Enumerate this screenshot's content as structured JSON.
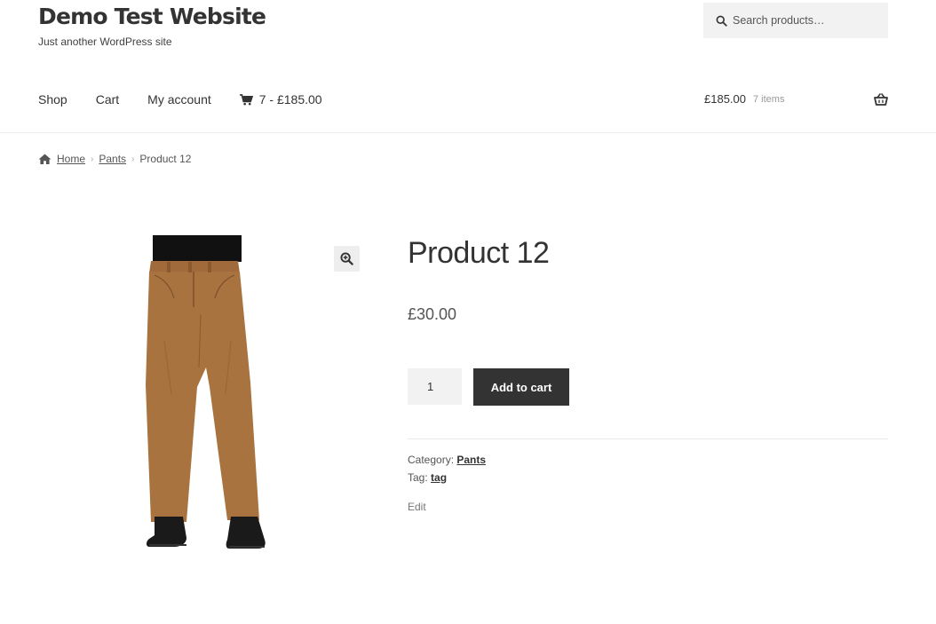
{
  "site": {
    "title": "Demo Test Website",
    "tagline": "Just another WordPress site"
  },
  "search": {
    "placeholder": "Search products…",
    "icon": "search-icon"
  },
  "nav": {
    "items": [
      {
        "label": "Shop"
      },
      {
        "label": "Cart"
      },
      {
        "label": "My account"
      }
    ],
    "cart_summary": "7 - £185.00",
    "cart_icon": "cart-icon"
  },
  "mini_cart": {
    "total": "£185.00",
    "count": "7 items",
    "icon": "basket-icon"
  },
  "breadcrumb": {
    "home": "Home",
    "category": "Pants",
    "current": "Product 12",
    "separator": "›"
  },
  "product": {
    "title": "Product 12",
    "price": "£30.00",
    "quantity": "1",
    "add_to_cart_label": "Add to cart",
    "category_label": "Category:",
    "category": "Pants",
    "tag_label": "Tag:",
    "tag": "tag",
    "edit_label": "Edit",
    "image_alt": "Brown work pants with black boots"
  },
  "colors": {
    "text": "#404040",
    "button": "#333333",
    "button_text": "#ffffff",
    "field_bg": "#f2f2f2"
  }
}
